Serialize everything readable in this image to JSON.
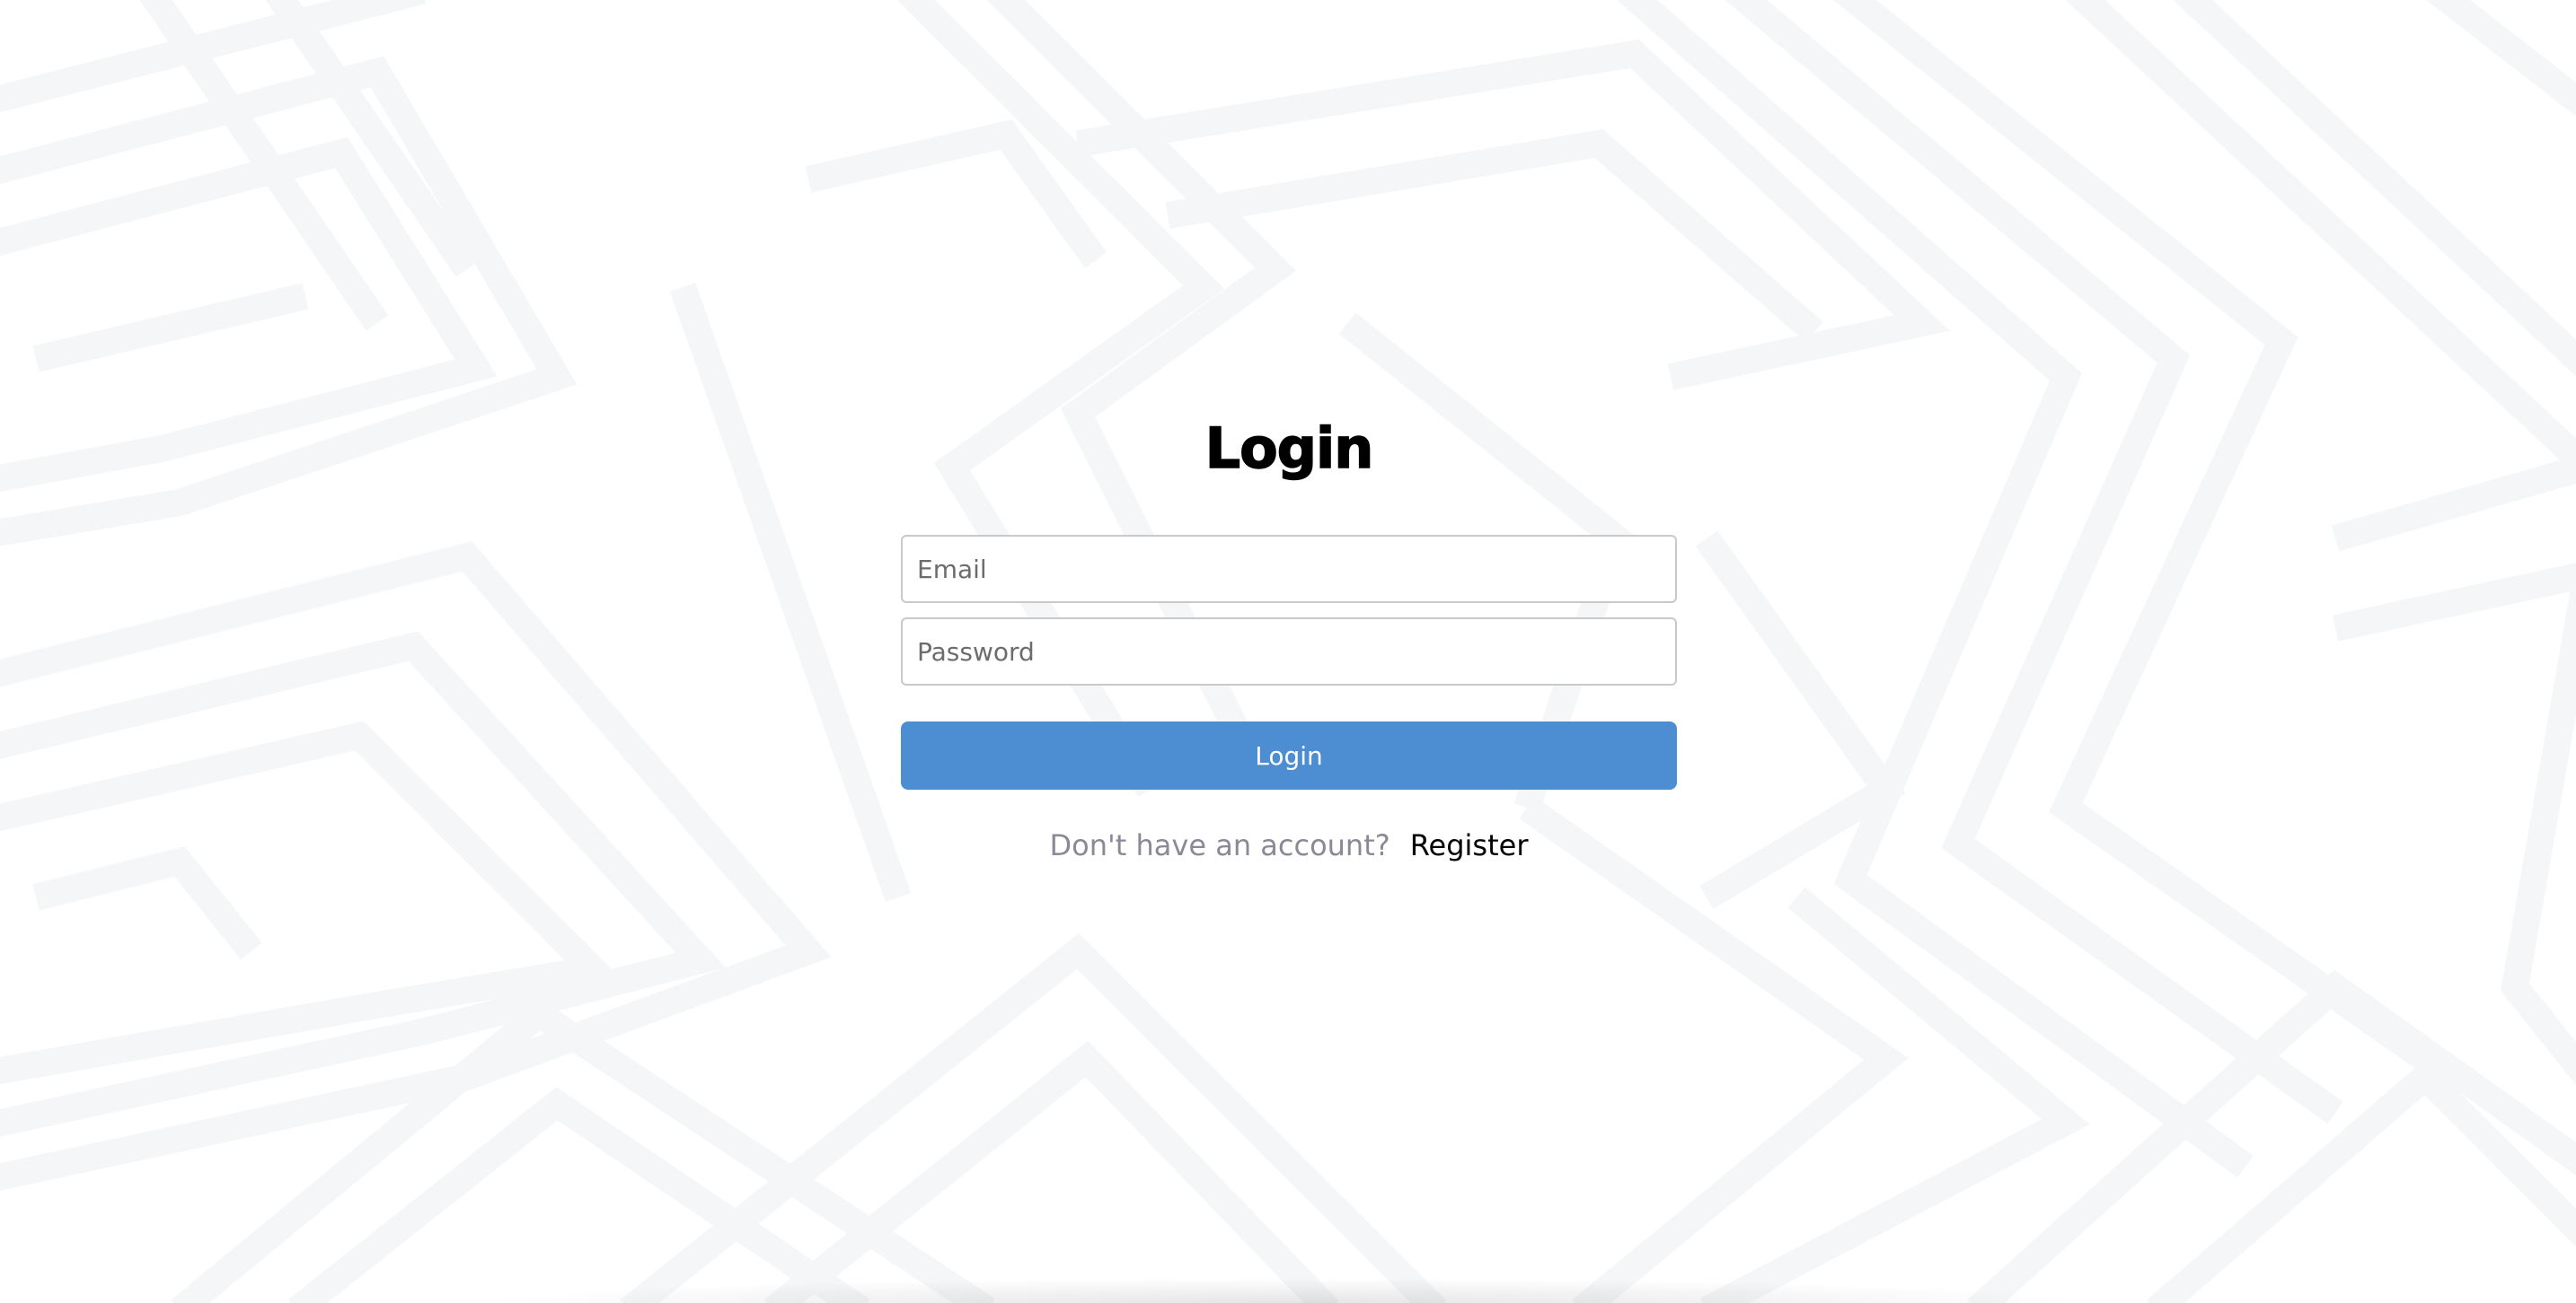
{
  "login": {
    "title": "Login",
    "email_placeholder": "Email",
    "password_placeholder": "Password",
    "button_label": "Login",
    "register_prompt": "Don't have an account?",
    "register_link": "Register"
  },
  "colors": {
    "button_bg": "#4d8ed3",
    "pattern_stripe": "#f5f6f8",
    "prompt_text": "#8a8a96"
  }
}
